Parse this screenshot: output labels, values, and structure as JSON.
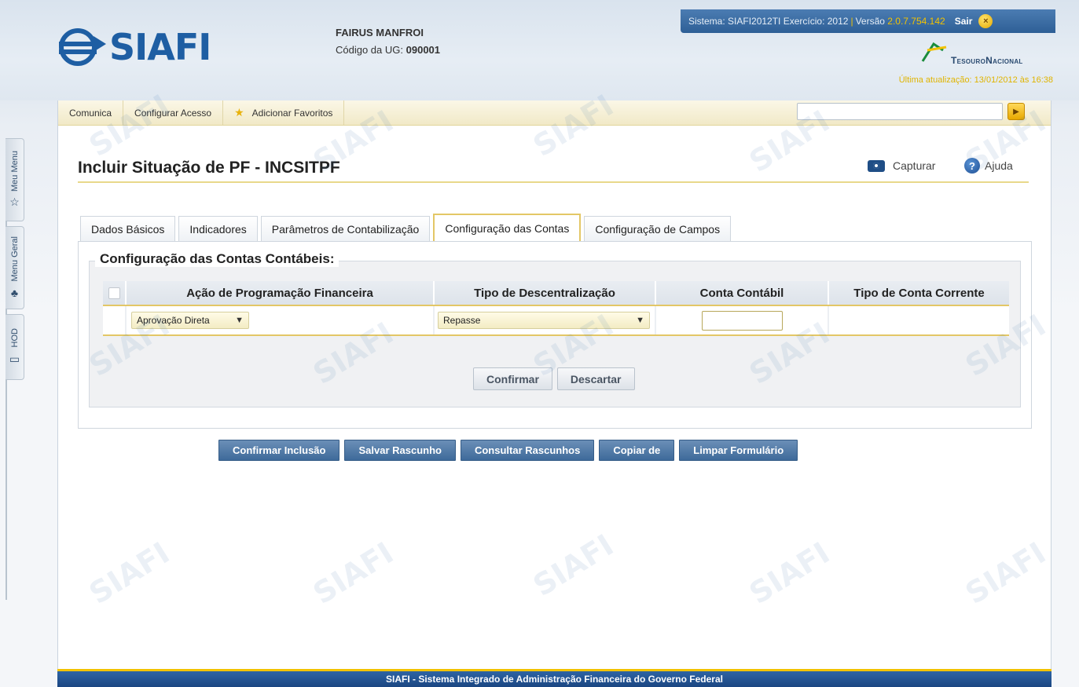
{
  "header": {
    "logo_text": "SIAFI",
    "user_name": "FAIRUS MANFROI",
    "ug_label": "Código da UG:",
    "ug_value": "090001",
    "system_label": "Sistema: SIAFI2012TI",
    "exercicio_label": "Exercício: 2012",
    "versao_label": "Versão",
    "versao_value": "2.0.7.754.142",
    "sair_label": "Sair",
    "tesouro_label": "TesouroNacional",
    "last_update": "Última atualização: 13/01/2012 às 16:38"
  },
  "toolbar": {
    "items": [
      "Comunica",
      "Configurar Acesso",
      "Adicionar Favoritos"
    ],
    "search_value": ""
  },
  "page": {
    "title": "Incluir Situação de PF - INCSITPF",
    "capturar_label": "Capturar",
    "ajuda_label": "Ajuda"
  },
  "tabs": [
    {
      "label": "Dados Básicos",
      "active": false
    },
    {
      "label": "Indicadores",
      "active": false
    },
    {
      "label": "Parâmetros de Contabilização",
      "active": false
    },
    {
      "label": "Configuração das Contas",
      "active": true
    },
    {
      "label": "Configuração de Campos",
      "active": false
    }
  ],
  "section": {
    "legend": "Configuração das Contas Contábeis:",
    "columns": [
      "Ação de Programação Financeira",
      "Tipo de Descentralização",
      "Conta Contábil",
      "Tipo de Conta Corrente"
    ],
    "rows": [
      {
        "acao": "Aprovação Direta",
        "tipo": "Repasse",
        "conta": "",
        "tipo_conta_corrente": ""
      }
    ],
    "confirm_label": "Confirmar",
    "discard_label": "Descartar"
  },
  "actions": [
    "Confirmar Inclusão",
    "Salvar Rascunho",
    "Consultar Rascunhos",
    "Copiar de",
    "Limpar Formulário"
  ],
  "side_tabs": [
    "Meu Menu",
    "Menu Geral",
    "HOD"
  ],
  "footer": "SIAFI - Sistema Integrado de Administração Financeira do Governo Federal",
  "watermark_text": "SIAFI",
  "colors": {
    "brand_blue": "#1e5ea3",
    "accent_yellow": "#e3c766",
    "button_blue": "#3e6a9a",
    "footer_blue": "#1b4682"
  }
}
